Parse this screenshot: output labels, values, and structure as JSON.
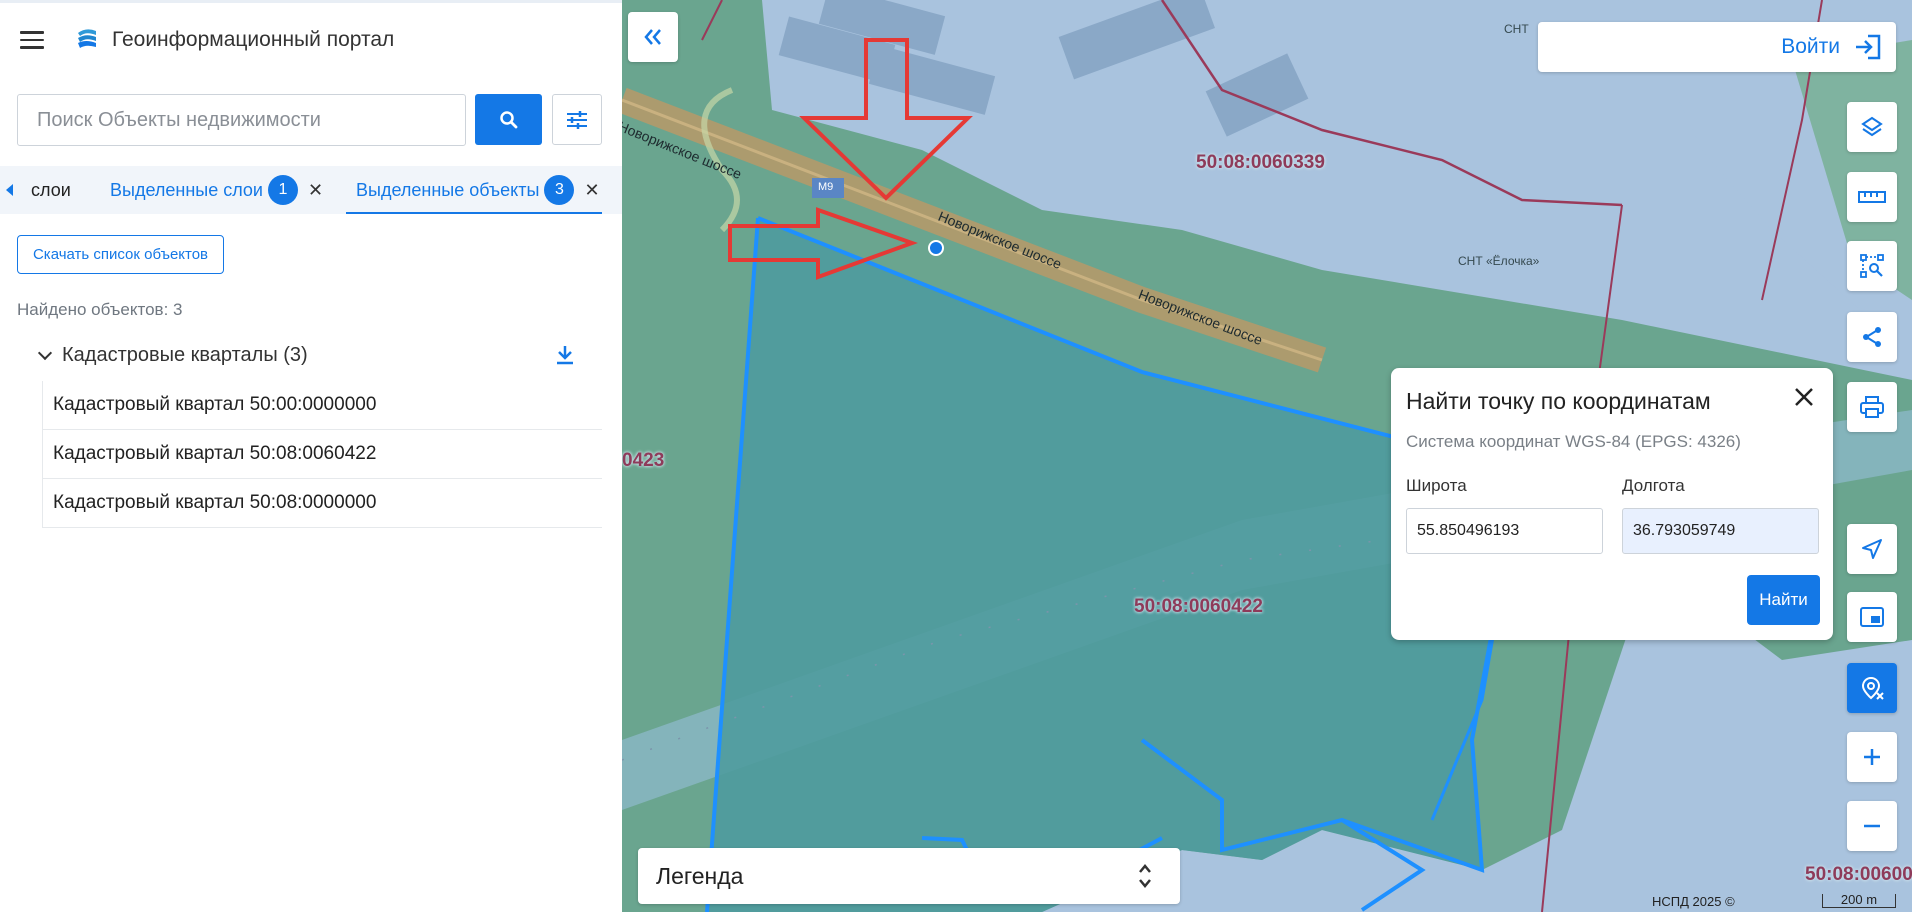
{
  "header": {
    "app_title": "Геоинформационный портал"
  },
  "search": {
    "placeholder": "Поиск Объекты недвижимости"
  },
  "tabs": [
    {
      "label": "слои"
    },
    {
      "label": "Выделенные слои",
      "badge": "1"
    },
    {
      "label": "Выделенные объекты",
      "badge": "3",
      "active": true
    }
  ],
  "results": {
    "download_label": "Скачать список объектов",
    "found_text": "Найдено объектов: 3",
    "group_label": "Кадастровые кварталы (3)",
    "items": [
      {
        "label": "Кадастровый квартал 50:00:0000000"
      },
      {
        "label": "Кадастровый квартал 50:08:0060422"
      },
      {
        "label": "Кадастровый квартал 50:08:0000000"
      }
    ]
  },
  "map": {
    "login_label": "Войти",
    "labels": {
      "parcel_339": "50:08:0060339",
      "parcel_422": "50:08:0060422",
      "parcel_edge_left": "0423",
      "parcel_edge_bottom": "50:08:00600",
      "snt": "СНТ",
      "snt_elochka": "СНТ «Ёлочка»",
      "road_1": "Новорижское шоссе",
      "road_2": "Новорижское шоссе",
      "road_3": "Новорижское шоссе",
      "road_shield": "М9"
    },
    "copyright": "НСПД 2025 ©",
    "scale": "200 m",
    "legend_label": "Легенда"
  },
  "coordinates_dialog": {
    "title": "Найти точку по координатам",
    "system": "Система координат WGS-84 (EPGS: 4326)",
    "lat_label": "Широта",
    "lat_value": "55.850496193",
    "lon_label": "Долгота",
    "lon_value": "36.793059749",
    "find_label": "Найти"
  },
  "colors": {
    "accent": "#1478e6",
    "parcel_label": "#8e3b5a",
    "arrow": "#e53935"
  }
}
